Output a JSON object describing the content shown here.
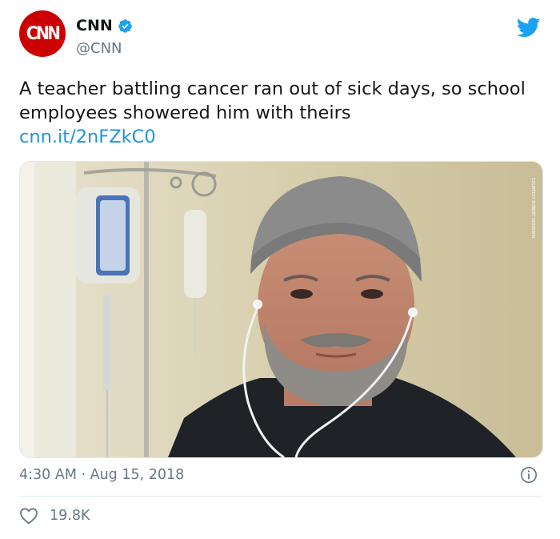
{
  "account": {
    "logo_text": "CNN",
    "display_name": "CNN",
    "handle": "@CNN",
    "verified": true
  },
  "tweet": {
    "text": "A teacher battling cancer ran out of sick days, so school employees showered him with theirs",
    "link": "cnn.it/2nFZkC0",
    "timestamp": "4:30 AM · Aug 15, 2018",
    "likes": "19.8K"
  },
  "media": {
    "description_icon": "photo",
    "watermark": "COURTESY ROBERT GOODWIN"
  },
  "icons": {
    "brand": "twitter-bird-icon",
    "verified": "verified-badge-icon",
    "info": "info-icon",
    "like": "heart-icon"
  },
  "colors": {
    "brand_red": "#cc0000",
    "twitter_blue": "#1da1f2",
    "link_blue": "#1b95e0",
    "secondary_text": "#657786",
    "divider": "#e1e8ed"
  }
}
